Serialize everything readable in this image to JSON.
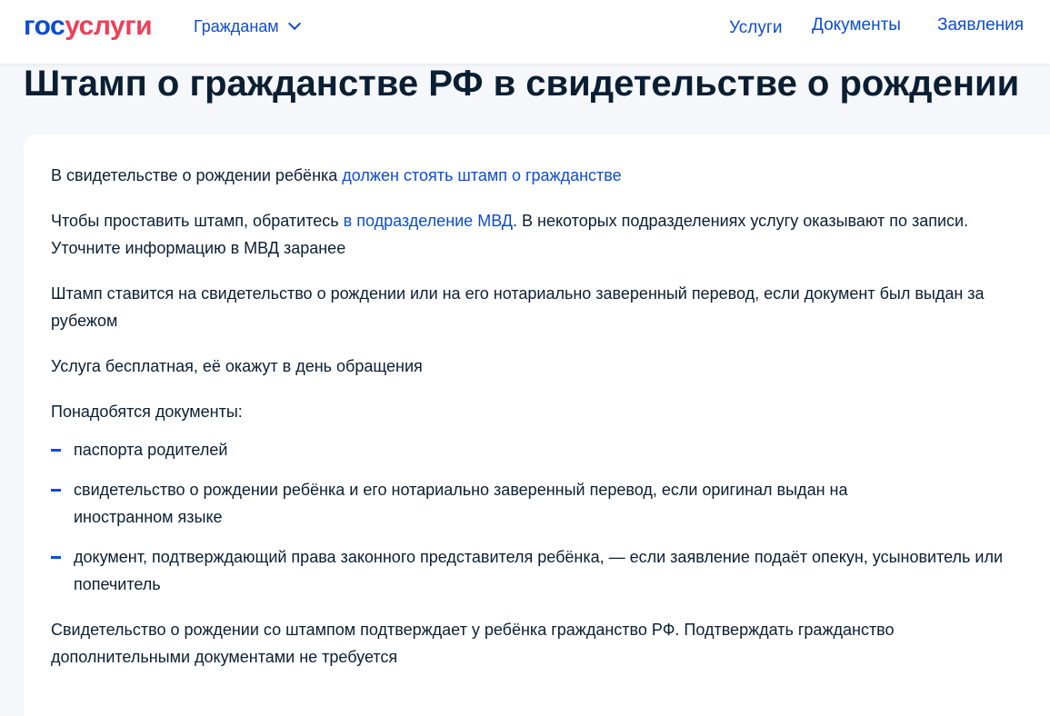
{
  "header": {
    "logo_part1": "гос",
    "logo_part2": "услуги",
    "audience_label": "Гражданам",
    "nav": {
      "services": "Услуги",
      "documents": "Документы",
      "applications": "Заявления"
    }
  },
  "page": {
    "title": "Штамп о гражданстве РФ в свидетельстве о рождении"
  },
  "content": {
    "p1_text": "В свидетельстве о рождении ребёнка ",
    "p1_link": "должен стоять штамп о гражданстве",
    "p2_text_before": "Чтобы проставить штамп, обратитесь ",
    "p2_link": "в подразделение МВД",
    "p2_text_after": ". В некоторых подразделениях услугу оказывают по записи. Уточните информацию в МВД заранее",
    "p3": "Штамп ставится на свидетельство о рождении или на его нотариально заверенный перевод, если документ был выдан за рубежом",
    "p4": "Услуга бесплатная, её окажут в день обращения",
    "docs_heading": "Понадобятся документы:",
    "docs": [
      "паспорта родителей",
      "свидетельство о рождении ребёнка и его нотариально заверенный перевод, если оригинал выдан на иностранном языке",
      "документ, подтверждающий права законного представителя ребёнка, — если заявление подаёт опекун, усыновитель или попечитель"
    ],
    "p5": "Свидетельство о рождении со штампом подтверждает у ребёнка гражданство РФ. Подтверждать гражданство дополнительными документами не требуется"
  },
  "colors": {
    "brand_blue": "#0d4cd3",
    "brand_red": "#ee3f58",
    "text": "#0b1f33",
    "background": "#f5f7fa"
  }
}
